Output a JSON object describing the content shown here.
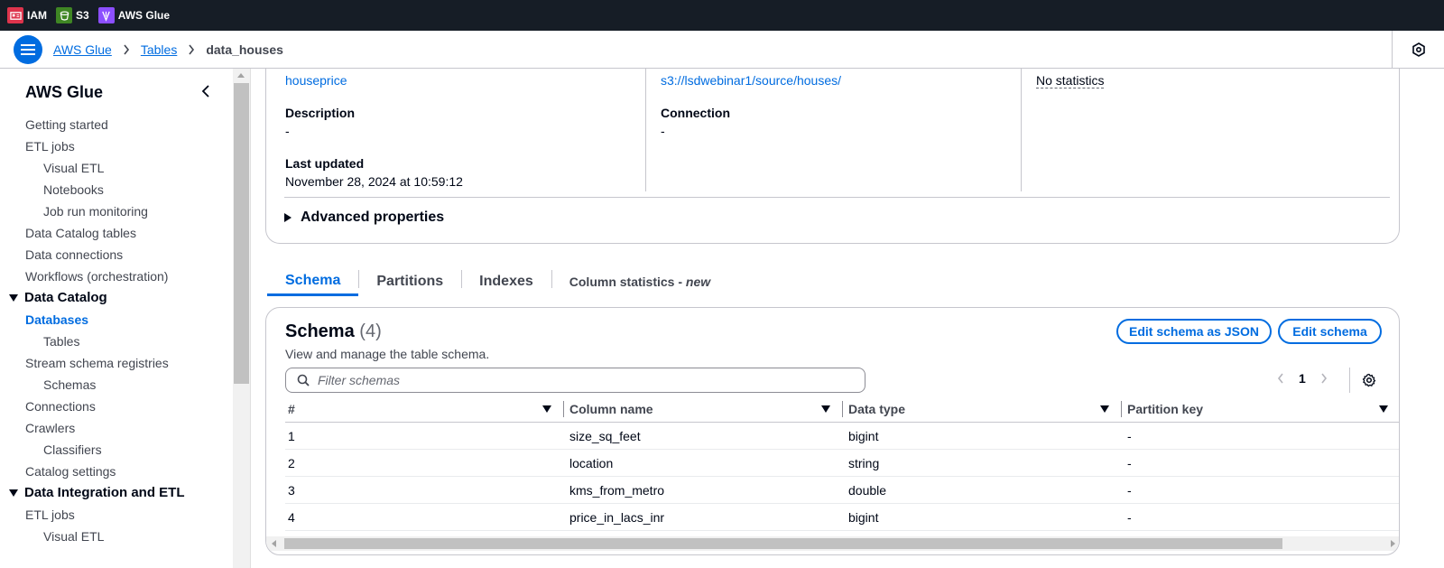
{
  "topbar": {
    "services": [
      {
        "label": "IAM",
        "icon": "iam-icon",
        "color": "#dd344c"
      },
      {
        "label": "S3",
        "icon": "s3-icon",
        "color": "#3f8624"
      },
      {
        "label": "AWS Glue",
        "icon": "glue-icon",
        "color": "#8c4fff"
      }
    ]
  },
  "breadcrumb": {
    "items": [
      "AWS Glue",
      "Tables"
    ],
    "current": "data_houses"
  },
  "sidebar": {
    "title": "AWS Glue",
    "items": [
      {
        "label": "Getting started",
        "level": 0
      },
      {
        "label": "ETL jobs",
        "level": 0
      },
      {
        "label": "Visual ETL",
        "level": 1
      },
      {
        "label": "Notebooks",
        "level": 1
      },
      {
        "label": "Job run monitoring",
        "level": 1
      },
      {
        "label": "Data Catalog tables",
        "level": 0
      },
      {
        "label": "Data connections",
        "level": 0
      },
      {
        "label": "Workflows (orchestration)",
        "level": 0
      },
      {
        "label": "Data Catalog",
        "level": "section"
      },
      {
        "label": "Databases",
        "level": 0,
        "active": true
      },
      {
        "label": "Tables",
        "level": 1
      },
      {
        "label": "Stream schema registries",
        "level": 0
      },
      {
        "label": "Schemas",
        "level": 1
      },
      {
        "label": "Connections",
        "level": 0
      },
      {
        "label": "Crawlers",
        "level": 0
      },
      {
        "label": "Classifiers",
        "level": 1
      },
      {
        "label": "Catalog settings",
        "level": 0
      },
      {
        "label": "Data Integration and ETL",
        "level": "section"
      },
      {
        "label": "ETL jobs",
        "level": 0
      },
      {
        "label": "Visual ETL",
        "level": 1
      }
    ]
  },
  "details": {
    "database_link": "houseprice",
    "location_link": "s3://lsdwebinar1/source/houses/",
    "statistics": "No statistics",
    "description_label": "Description",
    "description_value": "-",
    "connection_label": "Connection",
    "connection_value": "-",
    "last_updated_label": "Last updated",
    "last_updated_value": "November 28, 2024 at 10:59:12",
    "advanced_label": "Advanced properties"
  },
  "tabs": [
    {
      "label": "Schema",
      "active": true
    },
    {
      "label": "Partitions"
    },
    {
      "label": "Indexes"
    },
    {
      "label": "Column statistics - ",
      "suffix": "new"
    }
  ],
  "schema": {
    "title": "Schema",
    "count": "(4)",
    "description": "View and manage the table schema.",
    "edit_json_label": "Edit schema as JSON",
    "edit_label": "Edit schema",
    "filter_placeholder": "Filter schemas",
    "page": "1",
    "columns": [
      "#",
      "Column name",
      "Data type",
      "Partition key"
    ],
    "rows": [
      [
        "1",
        "size_sq_feet",
        "bigint",
        "-"
      ],
      [
        "2",
        "location",
        "string",
        "-"
      ],
      [
        "3",
        "kms_from_metro",
        "double",
        "-"
      ],
      [
        "4",
        "price_in_lacs_inr",
        "bigint",
        "-"
      ]
    ]
  }
}
